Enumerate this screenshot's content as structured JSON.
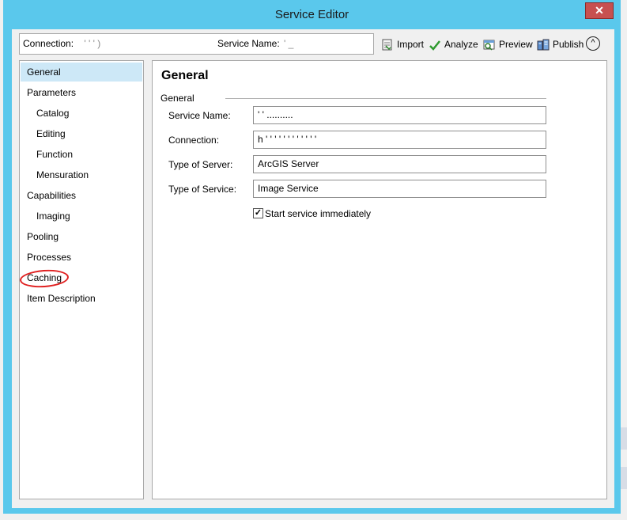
{
  "window": {
    "title": "Service Editor",
    "close_label": "✕"
  },
  "toolbar": {
    "connection_label": "Connection:",
    "connection_value": "' ' ' ) ",
    "service_name_label": "Service Name:",
    "service_name_value": "' _",
    "import_label": "Import",
    "analyze_label": "Analyze",
    "preview_label": "Preview",
    "publish_label": "Publish",
    "collapse_glyph": "^"
  },
  "nav": {
    "items": [
      {
        "label": "General"
      },
      {
        "label": "Parameters"
      },
      {
        "label": "Catalog"
      },
      {
        "label": "Editing"
      },
      {
        "label": "Function"
      },
      {
        "label": "Mensuration"
      },
      {
        "label": "Capabilities"
      },
      {
        "label": "Imaging"
      },
      {
        "label": "Pooling"
      },
      {
        "label": "Processes"
      },
      {
        "label": "Caching"
      },
      {
        "label": "Item Description"
      }
    ],
    "selected": "General"
  },
  "panel": {
    "title": "General",
    "group_label": "General",
    "fields": [
      {
        "label": "Service Name:",
        "value": "' ' .......... "
      },
      {
        "label": "Connection:",
        "value": "h ' ' ' ' ' ' ' ' ' ' ' ' "
      },
      {
        "label": "Type of Server:",
        "value": "ArcGIS Server"
      },
      {
        "label": "Type of Service:",
        "value": "Image Service"
      }
    ],
    "start_immediately": {
      "label": "Start service immediately",
      "checked_glyph": "✓"
    }
  },
  "colors": {
    "title_bar": "#5ac8ec",
    "close_button": "#c75050",
    "selection": "#cde8f7",
    "annotation": "#e02020"
  }
}
